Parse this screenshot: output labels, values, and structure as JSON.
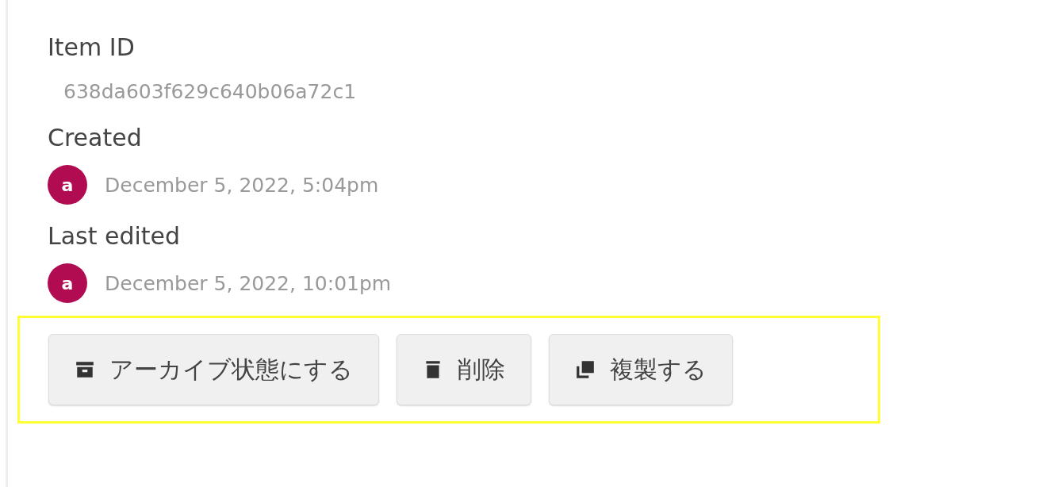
{
  "fields": [
    {
      "kind": "id",
      "label": "Item ID",
      "value": "638da603f629c640b06a72c1"
    },
    {
      "kind": "user",
      "label": "Created",
      "avatar": "a",
      "value": "December 5, 2022, 5:04pm"
    },
    {
      "kind": "user",
      "label": "Last edited",
      "avatar": "a",
      "value": "December 5, 2022, 10:01pm"
    }
  ],
  "actions": {
    "highlighted": true,
    "buttons": [
      {
        "kind": "archive",
        "label": "アーカイブ状態にする"
      },
      {
        "kind": "delete",
        "label": "削除"
      },
      {
        "kind": "duplicate",
        "label": "複製する"
      }
    ]
  }
}
